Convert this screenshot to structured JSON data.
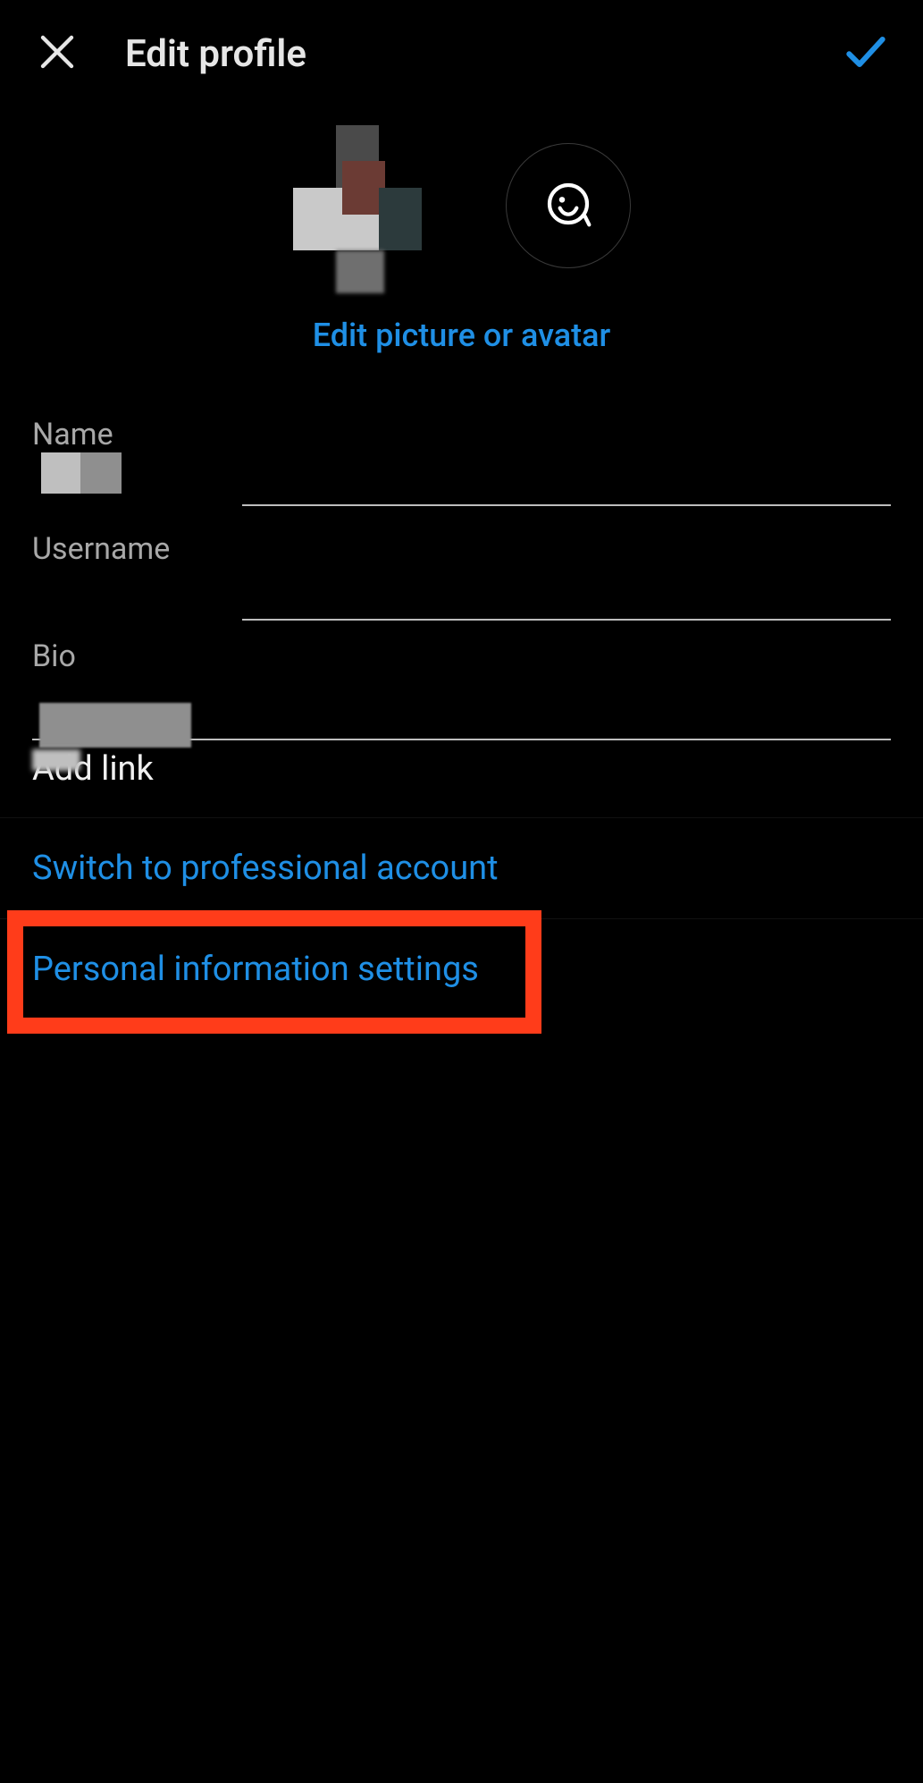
{
  "header": {
    "title": "Edit profile"
  },
  "avatar": {
    "edit_link": "Edit picture or avatar"
  },
  "fields": {
    "name": {
      "label": "Name",
      "value": ""
    },
    "username": {
      "label": "Username",
      "value": ""
    },
    "bio": {
      "label": "Bio",
      "value": ""
    },
    "add_link": "Add link"
  },
  "actions": {
    "switch_professional": "Switch to professional account",
    "personal_info": "Personal information settings"
  },
  "colors": {
    "accent": "#1f8fe5",
    "highlight": "#ff3c1a"
  }
}
